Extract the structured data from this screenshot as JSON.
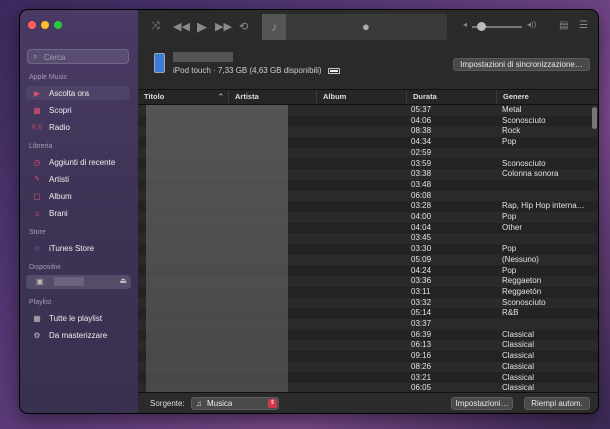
{
  "sidebar": {
    "search_placeholder": "Cerca",
    "sections": [
      {
        "title": "Apple Music",
        "items": [
          {
            "label": "Ascolta ora",
            "icon": "play-circle-icon",
            "glyph": "▶"
          },
          {
            "label": "Scopri",
            "icon": "grid-icon",
            "glyph": "▦"
          },
          {
            "label": "Radio",
            "icon": "radio-icon",
            "glyph": "((·))"
          }
        ]
      },
      {
        "title": "Libreria",
        "items": [
          {
            "label": "Aggiunti di recente",
            "icon": "clock-icon",
            "glyph": "◷"
          },
          {
            "label": "Artisti",
            "icon": "microphone-icon",
            "glyph": "🎤"
          },
          {
            "label": "Album",
            "icon": "album-icon",
            "glyph": "▢"
          },
          {
            "label": "Brani",
            "icon": "music-note-icon",
            "glyph": "♫"
          }
        ]
      },
      {
        "title": "Store",
        "items": [
          {
            "label": "iTunes Store",
            "icon": "star-icon",
            "glyph": "☆"
          }
        ]
      },
      {
        "title": "Dispositivi",
        "items": []
      },
      {
        "title": "Playlist",
        "items": [
          {
            "label": "Tutte le playlist",
            "icon": "playlist-grid-icon",
            "glyph": "▦"
          },
          {
            "label": "Da masterizzare",
            "icon": "gear-icon",
            "glyph": "⚙"
          }
        ]
      }
    ]
  },
  "device": {
    "info": "iPod touch · 7,33 GB (4,63 GB disponibili)",
    "sync_settings_label": "Impostazioni di sincronizzazione…"
  },
  "table": {
    "columns": [
      "Titolo",
      "Artista",
      "Album",
      "Durata",
      "Genere"
    ],
    "rows": [
      {
        "durata": "05:37",
        "genere": "Metal"
      },
      {
        "durata": "04:06",
        "genere": "Sconosciuto"
      },
      {
        "durata": "08:38",
        "genere": "Rock"
      },
      {
        "durata": "04:34",
        "genere": "Pop"
      },
      {
        "durata": "02:59",
        "genere": ""
      },
      {
        "durata": "03:59",
        "genere": "Sconosciuto"
      },
      {
        "durata": "03:38",
        "genere": "Colonna sonora"
      },
      {
        "durata": "03:48",
        "genere": ""
      },
      {
        "durata": "06:08",
        "genere": ""
      },
      {
        "durata": "03:28",
        "genere": "Rap, Hip Hop interna…"
      },
      {
        "durata": "04:00",
        "genere": "Pop"
      },
      {
        "durata": "04:04",
        "genere": "Other"
      },
      {
        "durata": "03:45",
        "genere": ""
      },
      {
        "durata": "03:30",
        "genere": "Pop"
      },
      {
        "durata": "05:09",
        "genere": "(Nessuno)"
      },
      {
        "durata": "04:24",
        "genere": "Pop"
      },
      {
        "durata": "03:36",
        "genere": "Reggaeton"
      },
      {
        "durata": "03:11",
        "genere": "Reggaetón"
      },
      {
        "durata": "03:32",
        "genere": "Sconosciuto"
      },
      {
        "durata": "05:14",
        "genere": "R&B"
      },
      {
        "durata": "03:37",
        "genere": ""
      },
      {
        "durata": "06:39",
        "genere": "Classical"
      },
      {
        "durata": "06:13",
        "genere": "Classical"
      },
      {
        "durata": "09:16",
        "genere": "Classical"
      },
      {
        "durata": "08:26",
        "genere": "Classical"
      },
      {
        "durata": "03:21",
        "genere": "Classical"
      },
      {
        "durata": "06:05",
        "genere": "Classical"
      }
    ]
  },
  "footer": {
    "source_label": "Sorgente:",
    "source_value": "Musica",
    "settings_label": "Impostazioni…",
    "autofill_label": "Riempi autom."
  },
  "colors": {
    "accent": "#e0506e",
    "close": "#ff5f57",
    "minimize": "#febc2e",
    "zoom": "#28c840"
  }
}
